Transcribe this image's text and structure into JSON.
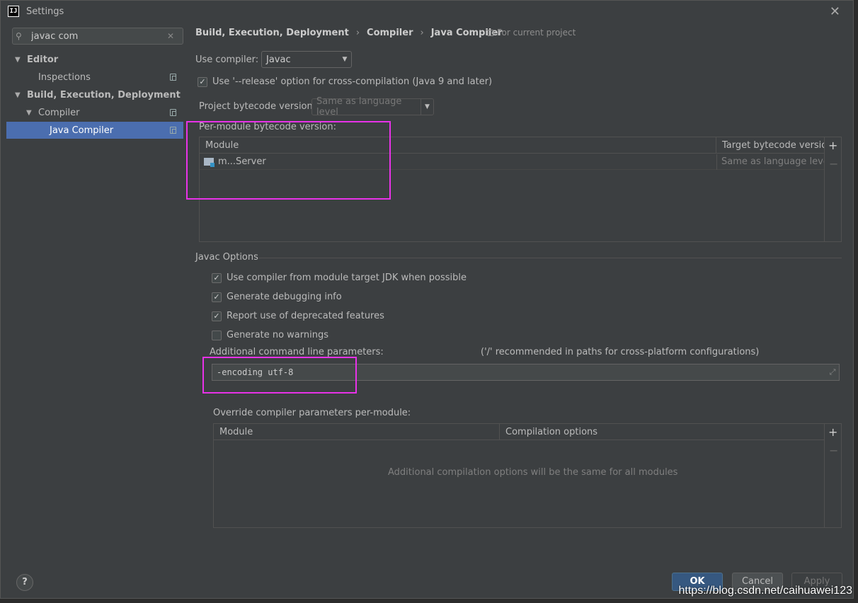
{
  "window": {
    "title": "Settings",
    "app_icon_text": "IJ",
    "close_label": "✕"
  },
  "sidebar": {
    "search_value": "javac com",
    "items": [
      {
        "label": "Editor",
        "arrow": "▼"
      },
      {
        "label": "Inspections"
      },
      {
        "label": "Build, Execution, Deployment",
        "arrow": "▼"
      },
      {
        "label": "Compiler",
        "arrow": "▼"
      },
      {
        "label": "Java Compiler"
      }
    ]
  },
  "main": {
    "breadcrumb": [
      "Build, Execution, Deployment",
      "Compiler",
      "Java Compiler"
    ],
    "breadcrumb_sep": "›",
    "for_current_project": "For current project",
    "use_compiler_label": "Use compiler:",
    "use_compiler_value": "Javac",
    "release_option_label": "Use '--release' option for cross-compilation (Java 9 and later)",
    "project_bytecode_label": "Project bytecode version:",
    "project_bytecode_value": "Same as language level",
    "per_module_label": "Per-module bytecode version:",
    "module_table": {
      "columns": [
        "Module",
        "Target bytecode version"
      ],
      "rows": [
        {
          "module": "m...Server",
          "target": "Same as language level"
        }
      ]
    },
    "javac_options_title": "Javac Options",
    "javac_checkboxes": [
      {
        "label": "Use compiler from module target JDK when possible",
        "checked": true
      },
      {
        "label": "Generate debugging info",
        "checked": true
      },
      {
        "label": "Report use of deprecated features",
        "checked": true
      },
      {
        "label": "Generate no warnings",
        "checked": false
      }
    ],
    "additional_params_label": "Additional command line parameters:",
    "additional_params_hint": "('/' recommended in paths for cross-platform configurations)",
    "additional_params_value": "-encoding utf-8",
    "override_label": "Override compiler parameters per-module:",
    "override_table": {
      "columns": [
        "Module",
        "Compilation options"
      ],
      "empty_text": "Additional compilation options will be the same for all modules"
    }
  },
  "footer": {
    "help_label": "?",
    "ok_label": "OK",
    "cancel_label": "Cancel",
    "apply_label": "Apply"
  },
  "watermark": "https://blog.csdn.net/caihuawei123",
  "colors": {
    "accent": "#4b6eaf",
    "highlight": "#e832e8",
    "ok_button": "#365880"
  }
}
